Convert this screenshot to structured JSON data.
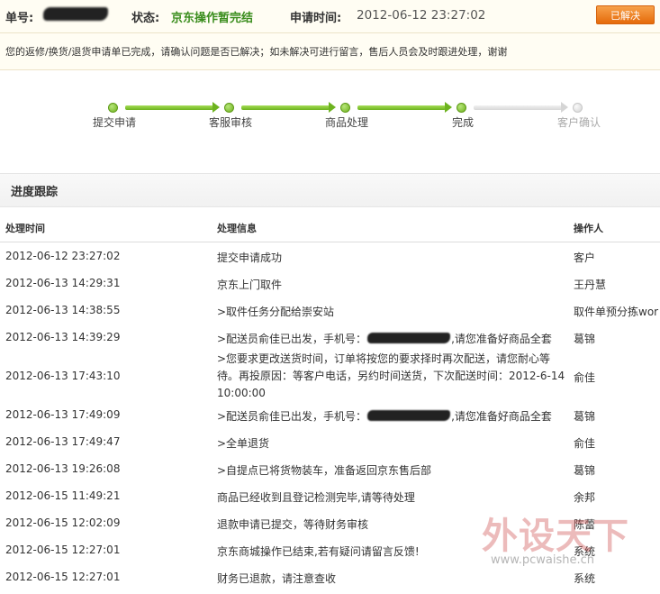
{
  "header": {
    "order_label": "单号:",
    "status_label": "状态:",
    "status_value": "京东操作暂完结",
    "apply_time_label": "申请时间:",
    "apply_time_value": "2012-06-12 23:27:02",
    "resolved_button": "已解决"
  },
  "notice": "您的返修/换货/退货申请单已完成，请确认问题是否已解决；如未解决可进行留言，售后人员会及时跟进处理，谢谢",
  "steps": [
    {
      "label": "提交申请",
      "done": true
    },
    {
      "label": "客服审核",
      "done": true
    },
    {
      "label": "商品处理",
      "done": true
    },
    {
      "label": "完成",
      "done": true
    },
    {
      "label": "客户确认",
      "done": false
    }
  ],
  "progress": {
    "section_title": "进度跟踪",
    "columns": {
      "time": "处理时间",
      "info": "处理信息",
      "operator": "操作人"
    },
    "rows": [
      {
        "time": "2012-06-12 23:27:02",
        "info": "提交申请成功",
        "operator": "客户"
      },
      {
        "time": "2012-06-13 14:29:31",
        "info": "京东上门取件",
        "operator": "王丹慧"
      },
      {
        "time": "2012-06-13 14:38:55",
        "info": ">取件任务分配给崇安站",
        "operator": "取件单预分拣wor"
      },
      {
        "time": "2012-06-13 14:39:29",
        "info_pre": ">配送员俞佳已出发，手机号：",
        "info_post": ",请您准备好商品全套",
        "operator": "葛锦"
      },
      {
        "time": "2012-06-13 17:43:10",
        "info": ">您要求更改送货时间，订单将按您的要求择时再次配送，请您耐心等待。再投原因：等客户电话，另约时间送货，下次配送时间：2012-6-14 10:00:00",
        "operator": "俞佳"
      },
      {
        "time": "2012-06-13 17:49:09",
        "info_pre": ">配送员俞佳已出发，手机号：",
        "info_post": ",请您准备好商品全套",
        "operator": "葛锦"
      },
      {
        "time": "2012-06-13 17:49:47",
        "info": ">全单退货",
        "operator": "俞佳"
      },
      {
        "time": "2012-06-13 19:26:08",
        "info": ">自提点已将货物装车，准备返回京东售后部",
        "operator": "葛锦"
      },
      {
        "time": "2012-06-15 11:49:21",
        "info": "商品已经收到且登记检测完毕,请等待处理",
        "operator": "余邦"
      },
      {
        "time": "2012-06-15 12:02:09",
        "info": "退款申请已提交，等待财务审核",
        "operator": "陈蕾"
      },
      {
        "time": "2012-06-15 12:27:01",
        "info": "京东商城操作已结束,若有疑问请留言反馈!",
        "operator": "系统"
      },
      {
        "time": "2012-06-15 12:27:01",
        "info": "财务已退款，请注意查收",
        "operator": "系统"
      }
    ]
  },
  "watermark": {
    "text": "外设天下",
    "url": "www.pcwaishe.cn"
  },
  "colors": {
    "status": "#3a8d1d",
    "button": "#ef8222",
    "step_done": "#6fb21e",
    "step_pending": "#d3d3d3"
  }
}
